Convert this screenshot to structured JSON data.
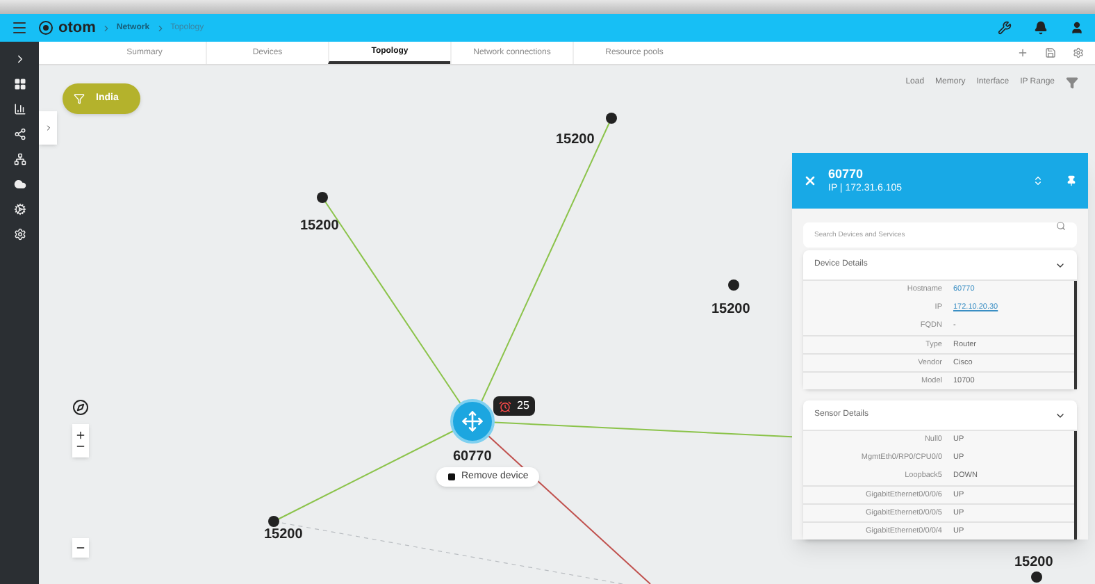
{
  "header": {
    "logo": "otom",
    "breadcrumb": [
      "Network",
      "Topology"
    ]
  },
  "tabs": [
    {
      "label": "Summary",
      "selected": false
    },
    {
      "label": "Devices",
      "selected": false
    },
    {
      "label": "Topology",
      "selected": true
    },
    {
      "label": "Network connections",
      "selected": false
    },
    {
      "label": "Resource pools",
      "selected": false
    }
  ],
  "filter": {
    "label": "India"
  },
  "legend": [
    "Load",
    "Memory",
    "Interface",
    "IP Range"
  ],
  "nodes": [
    {
      "label": "15200",
      "kind": "site"
    },
    {
      "label": "15200",
      "kind": "site"
    },
    {
      "label": "15200",
      "kind": "site"
    },
    {
      "label": "15200",
      "kind": "site"
    },
    {
      "label": "15200",
      "kind": "site"
    },
    {
      "label": "60770",
      "kind": "device"
    }
  ],
  "device_popup": {
    "alarm_count": "25",
    "action": "Remove device"
  },
  "panel": {
    "title": "60770",
    "subtitle": "IP | 172.31.6.105",
    "search": {
      "placeholder": "Search Devices and Services"
    },
    "sections": [
      {
        "title": "Device Details",
        "expanded": true,
        "rows": [
          {
            "label": "Hostname",
            "value": "60770",
            "kind": "link"
          },
          {
            "label": "IP",
            "value": "172.10.20.30",
            "kind": "url"
          },
          {
            "label": "FQDN",
            "value": "-",
            "kind": "text"
          },
          {
            "label": "Type",
            "value": "Router",
            "kind": "text"
          },
          {
            "label": "Vendor",
            "value": "Cisco",
            "kind": "text"
          },
          {
            "label": "Model",
            "value": "10700",
            "kind": "text"
          }
        ]
      },
      {
        "title": "Sensor Details",
        "expanded": true,
        "rows": [
          {
            "label": "Null0",
            "value": "UP",
            "kind": "text"
          },
          {
            "label": "MgmtEth0/RP0/CPU0/0",
            "value": "UP",
            "kind": "text"
          },
          {
            "label": "Loopback5",
            "value": "DOWN",
            "kind": "text"
          },
          {
            "label": "GigabitEthernet0/0/0/6",
            "value": "UP",
            "kind": "text"
          },
          {
            "label": "GigabitEthernet0/0/0/5",
            "value": "UP",
            "kind": "text"
          },
          {
            "label": "GigabitEthernet0/0/0/4",
            "value": "UP",
            "kind": "text"
          }
        ]
      }
    ]
  }
}
